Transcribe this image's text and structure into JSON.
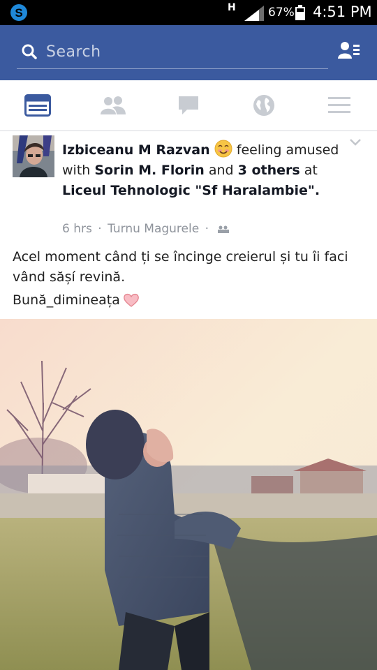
{
  "status_bar": {
    "network_type": "H",
    "battery_percent": "67%",
    "time": "4:51 PM",
    "icons": [
      "skype-icon",
      "signal-icon",
      "battery-icon"
    ]
  },
  "header": {
    "search_placeholder": "Search",
    "icons": [
      "search-icon",
      "friend-requests-icon"
    ],
    "background_color": "#3b5a9f"
  },
  "tabs": [
    {
      "name": "news-feed",
      "icon": "news-feed-icon",
      "active": true,
      "color": "#3b5a9f"
    },
    {
      "name": "friends",
      "icon": "friends-icon",
      "active": false,
      "color": "#c8ccd2"
    },
    {
      "name": "messages",
      "icon": "chat-bubble-icon",
      "active": false,
      "color": "#c8ccd2"
    },
    {
      "name": "notifications",
      "icon": "globe-icon",
      "active": false,
      "color": "#c8ccd2"
    },
    {
      "name": "more",
      "icon": "menu-icon",
      "active": false,
      "color": "#c8ccd2"
    }
  ],
  "post": {
    "author": "Izbiceanu M Razvan",
    "feeling_emoji": "smiling-face-emoji",
    "feeling_text": "feeling amused with",
    "tagged_1": "Sorin M. Florin",
    "and_word": "and",
    "tagged_others": "3 others",
    "at_word": "at",
    "location": "Liceul Tehnologic \"Sf Haralambie\"",
    "period": ".",
    "time": "6 hrs",
    "place": "Turnu Magurele",
    "separator": "·",
    "audience_icon": "friends-audience-icon",
    "message": "Acel moment când ți se încinge creierul și tu îi faci vând sășí revină.",
    "hashtag": "Bună_dimineața",
    "heart_emoji": "pink-heart-emoji"
  }
}
